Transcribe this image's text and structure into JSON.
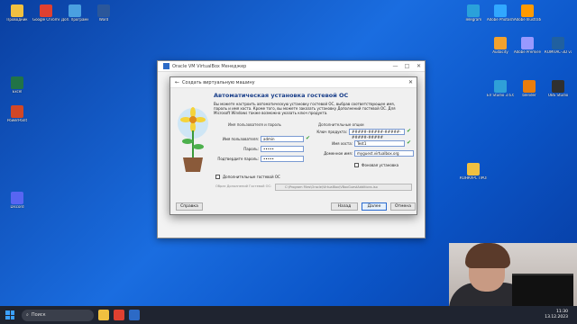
{
  "desktop": {
    "icons": [
      {
        "label": "Проводник",
        "color": "#f0c040"
      },
      {
        "label": "Google Chrome",
        "color": "#e04030"
      },
      {
        "label": "Доп. программы",
        "color": "#4aa0e0"
      },
      {
        "label": "Word",
        "color": "#2b579a"
      },
      {
        "label": "Excel",
        "color": "#217346"
      },
      {
        "label": "PowerPoint",
        "color": "#d24726"
      },
      {
        "label": "Discord",
        "color": "#5865f2"
      },
      {
        "label": "Telegram",
        "color": "#2aa1da"
      },
      {
        "label": "Adobe Photoshop",
        "color": "#31a8ff"
      },
      {
        "label": "Adobe Illustrator",
        "color": "#ff9a00"
      },
      {
        "label": "Adobe Premiere Pro",
        "color": "#9999ff"
      },
      {
        "label": "Audacity",
        "color": "#f2a22e"
      },
      {
        "label": "EV Studio 3.6.6",
        "color": "#2fa0d8"
      },
      {
        "label": "blender",
        "color": "#e87d0d"
      },
      {
        "label": "OBS Studio",
        "color": "#303030"
      },
      {
        "label": "КОМПАС-3D v18.1",
        "color": "#2060a0"
      },
      {
        "label": "IT-CUBE Site",
        "color": "#1a1a1a"
      },
      {
        "label": "КОНКУРС ПРОЕКТОВ",
        "color": "#f0c040"
      }
    ]
  },
  "vbox_main": {
    "title": "Oracle VM VirtualBox Менеджер",
    "min": "—",
    "max": "□",
    "close": "✕"
  },
  "dialog": {
    "window_title": "Создать виртуальную машину",
    "close": "✕",
    "heading": "Автоматическая установка гостевой ОС",
    "description": "Вы можете настроить автоматическую установку гостевой ОС, выбрав соответствующее имя, пароль и имя хоста. Кроме того, вы можете заказать установку Дополнений гостевой ОС. Для Microsoft Windows также возможно указать ключ продукта.",
    "group_user": "Имя пользователя и пароль",
    "group_extra": "Дополнительные опции",
    "username_label": "Имя пользователя:",
    "username_value": "admin",
    "password_label": "Пароль:",
    "password_value": "•••••",
    "confirm_label": "Подтвердите пароль:",
    "confirm_value": "•••••",
    "product_key_label": "Ключ продукта:",
    "product_key_value": "#####-#####-#####-#####-#####",
    "hostname_label": "Имя хоста:",
    "hostname_value": "Test1",
    "domain_label": "Доменное имя:",
    "domain_value": "myguest.virtualbox.org",
    "background_install_label": "Фоновая установка",
    "guest_additions_label": "Дополнительные гостевой ОС",
    "iso_label": "Образ Дополнений Гостевой ОС:",
    "iso_value": "C:\\Program Files\\Oracle\\VirtualBox\\VBoxGuestAdditions.iso",
    "help_button": "Справка",
    "back_button": "Назад",
    "next_button": "Далее",
    "cancel_button": "Отмена"
  },
  "taskbar": {
    "search_placeholder": "Поиск",
    "time": "11:30",
    "date": "13.12.2023"
  }
}
